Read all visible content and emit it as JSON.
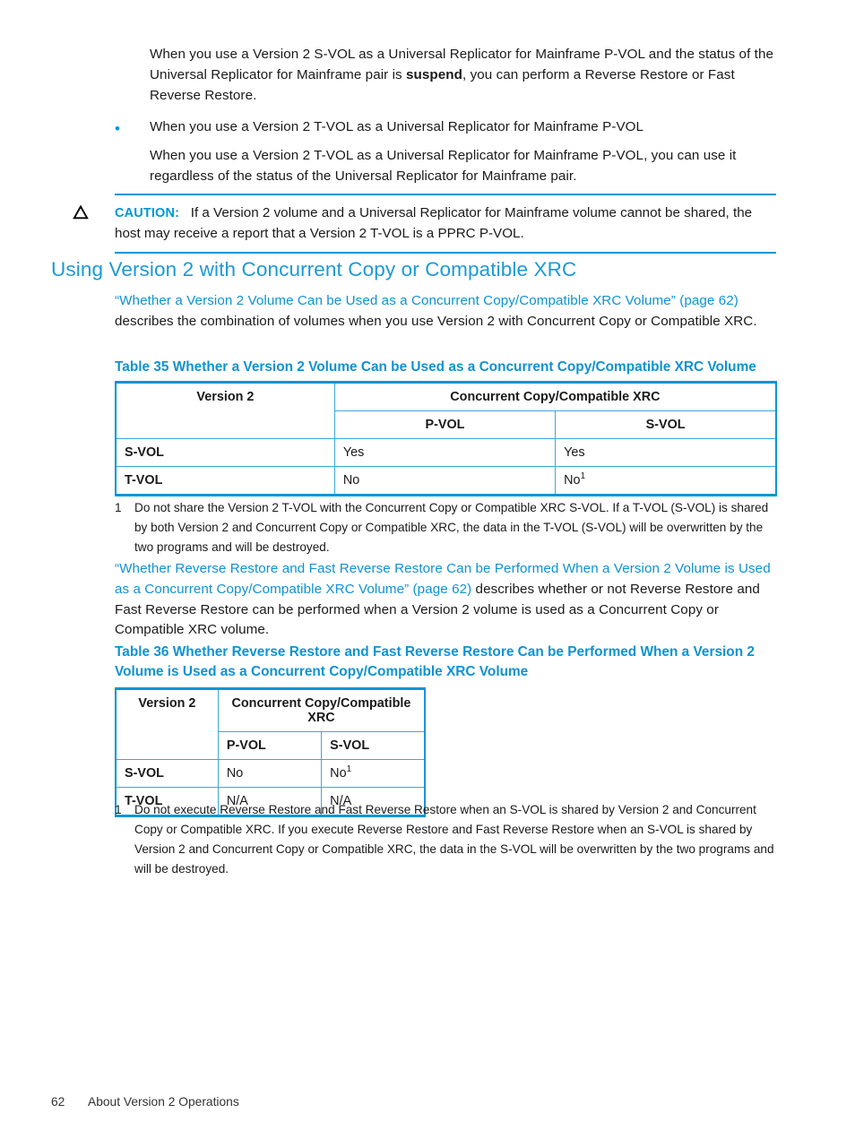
{
  "accent": {
    "blue": "#0096D6",
    "link": "#0E93D3",
    "heading": "#1B9AD6",
    "table_border": "#3AA9DE"
  },
  "intro": {
    "paragraph_1_before": "When you use a Version 2 S-VOL as a Universal Replicator for Mainframe P-VOL and the status of the Universal Replicator for Mainframe pair is ",
    "paragraph_1_bold": "suspend",
    "paragraph_1_after": ", you can perform a Reverse Restore or Fast Reverse Restore."
  },
  "bullet": {
    "marker": "•",
    "line_1": "When you use a Version 2 T-VOL as a Universal Replicator for Mainframe P-VOL",
    "line_2": "When you use a Version 2 T-VOL as a Universal Replicator for Mainframe P-VOL, you can use it regardless of the status of the Universal Replicator for Mainframe pair."
  },
  "caution": {
    "icon": "warning-triangle-icon",
    "label": "CAUTION:",
    "text": "If a Version 2 volume and a Universal Replicator for Mainframe volume cannot be shared, the host may receive a report that a Version 2 T-VOL is a PPRC P-VOL."
  },
  "section": {
    "heading": "Using Version 2 with Concurrent Copy or Compatible XRC"
  },
  "para_1": {
    "link_text": "“Whether a Version 2 Volume Can be Used as a Concurrent Copy/Compatible XRC Volume” (page 62)",
    "rest": " describes the combination of volumes when you use Version 2 with Concurrent Copy or Compatible XRC."
  },
  "table35": {
    "caption": "Table 35 Whether a Version 2 Volume Can be Used as a Concurrent Copy/Compatible XRC Volume",
    "header_left": "Version 2",
    "header_group": "Concurrent Copy/Compatible XRC",
    "subheaders": [
      "P-VOL",
      "S-VOL"
    ],
    "rows": [
      {
        "label": "S-VOL",
        "pvol": "Yes",
        "svol": "Yes",
        "svol_note": ""
      },
      {
        "label": "T-VOL",
        "pvol": "No",
        "svol": "No",
        "svol_note": "1"
      }
    ],
    "footnote_num": "1",
    "footnote_text": "Do not share the Version 2 T-VOL with the Concurrent Copy or Compatible XRC S-VOL. If a T-VOL (S-VOL) is shared by both Version 2 and Concurrent Copy or Compatible XRC, the data in the T-VOL (S-VOL) will be overwritten by the two programs and will be destroyed."
  },
  "para_2": {
    "link_text": "“Whether Reverse Restore and Fast Reverse Restore Can be Performed When a Version 2 Volume is Used as a Concurrent Copy/Compatible XRC Volume” (page 62)",
    "rest": " describes whether or not Reverse Restore and Fast Reverse Restore can be performed when a Version 2 volume is used as a Concurrent Copy or Compatible XRC volume."
  },
  "table36": {
    "caption": "Table 36 Whether Reverse Restore and Fast Reverse Restore Can be Performed When a Version 2 Volume is Used as a Concurrent Copy/Compatible XRC Volume",
    "header_left": "Version 2",
    "header_group": "Concurrent Copy/Compatible XRC",
    "subheaders": [
      "P-VOL",
      "S-VOL"
    ],
    "rows": [
      {
        "label": "S-VOL",
        "pvol": "No",
        "svol": "No",
        "svol_note": "1"
      },
      {
        "label": "T-VOL",
        "pvol": "N/A",
        "svol": "N/A",
        "svol_note": ""
      }
    ],
    "footnote_num": "1",
    "footnote_text": "Do not execute Reverse Restore and Fast Reverse Restore when an S-VOL is shared by Version 2 and Concurrent Copy or Compatible XRC. If you execute Reverse Restore and Fast Reverse Restore when an S-VOL is shared by Version 2 and Concurrent Copy or Compatible XRC, the data in the S-VOL will be overwritten by the two programs and will be destroyed."
  },
  "footer": {
    "page_number": "62",
    "chapter": "About Version 2 Operations"
  }
}
